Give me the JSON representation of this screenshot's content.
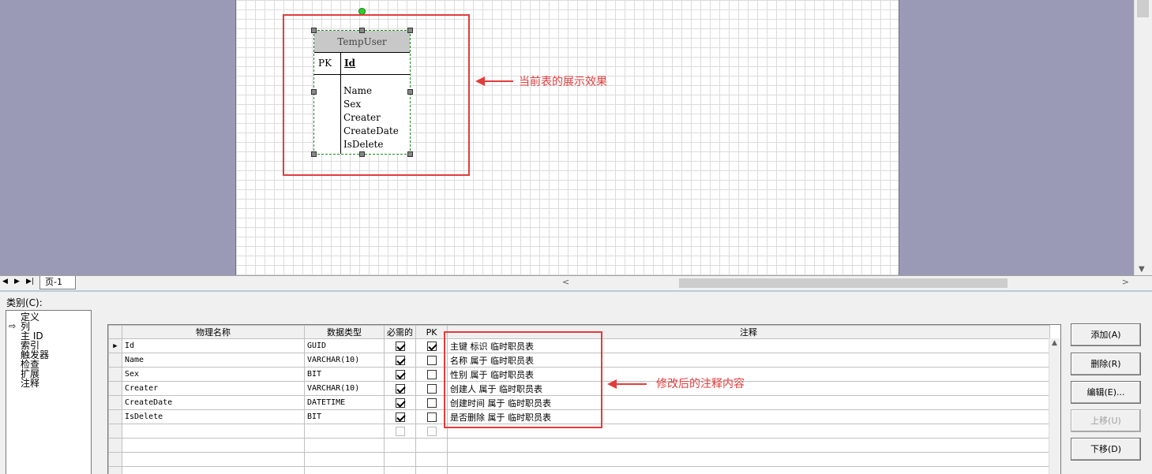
{
  "entity": {
    "name": "TempUser",
    "pk_label": "PK",
    "pk_field": "Id",
    "fields": [
      "Name",
      "Sex",
      "Creater",
      "CreateDate",
      "IsDelete"
    ]
  },
  "annotations": {
    "top": "当前表的展示效果",
    "bottom": "修改后的注释内容"
  },
  "page_tab": "页-1",
  "category": {
    "label": "类别(C):",
    "items": [
      "定义",
      "列",
      "主 ID",
      "索引",
      "触发器",
      "检查",
      "扩展",
      "注释"
    ],
    "selected_index": 1
  },
  "grid": {
    "headers": [
      "物理名称",
      "数据类型",
      "必需的",
      "PK",
      "注释"
    ],
    "rows": [
      {
        "name": "Id",
        "type": "GUID",
        "required": true,
        "pk": true,
        "comment": "主键 标识 临时职员表"
      },
      {
        "name": "Name",
        "type": "VARCHAR(10)",
        "required": true,
        "pk": false,
        "comment": "名称 属于 临时职员表"
      },
      {
        "name": "Sex",
        "type": "BIT",
        "required": true,
        "pk": false,
        "comment": "性别 属于 临时职员表"
      },
      {
        "name": "Creater",
        "type": "VARCHAR(10)",
        "required": true,
        "pk": false,
        "comment": "创建人 属于 临时职员表"
      },
      {
        "name": "CreateDate",
        "type": "DATETIME",
        "required": true,
        "pk": false,
        "comment": "创建时间 属于 临时职员表"
      },
      {
        "name": "IsDelete",
        "type": "BIT",
        "required": true,
        "pk": false,
        "comment": "是否删除 属于 临时职员表"
      }
    ]
  },
  "buttons": {
    "add": "添加(A)",
    "delete": "删除(R)",
    "edit": "编辑(E)...",
    "move_up": "上移(U)",
    "move_down": "下移(D)"
  },
  "colors": {
    "annotation_red": "#e23c3c",
    "selection_green": "#1a8a1a",
    "canvas_bg": "#9a9ab6"
  }
}
